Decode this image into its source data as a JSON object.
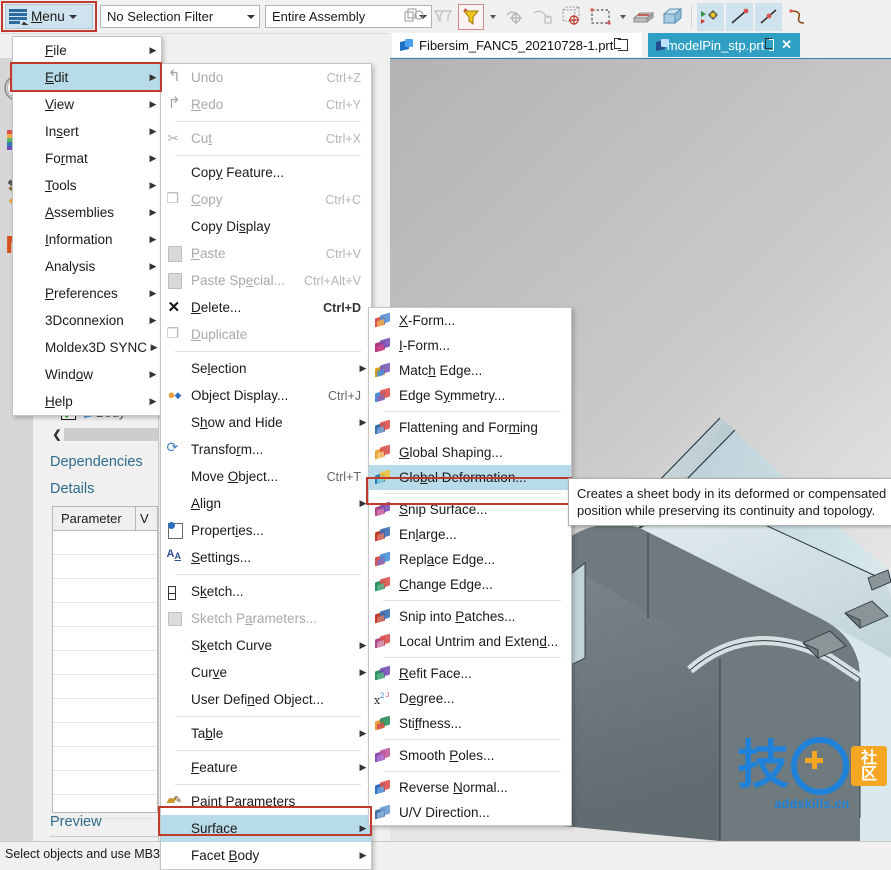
{
  "toolbar": {
    "menu_button_label": "Menu",
    "selection_filter": "No Selection Filter",
    "scope": "Entire Assembly",
    "icons": [
      "snap-point-icon",
      "filter-face-icon",
      "filter-active-icon",
      "filter-dropdown-caret",
      "point-constructor-icon",
      "curve-rule-icon",
      "wcs-dynamic-icon",
      "rectangle-select-icon",
      "select-dropdown-caret",
      "block-icon",
      "box-icon",
      "move-face-icon",
      "line-icon",
      "line-point-icon",
      "spline-icon"
    ]
  },
  "tabs": [
    {
      "label": "Fibersim_FANC5_20210728-1.prt",
      "active": false,
      "closeable": false
    },
    {
      "label": "modelPin_stp.prt",
      "active": true,
      "closeable": true
    }
  ],
  "main_menu": {
    "items": [
      {
        "label": "File",
        "underline": "F",
        "submenu": true,
        "highlighted": false
      },
      {
        "label": "Edit",
        "underline": "E",
        "submenu": true,
        "highlighted": true
      },
      {
        "label": "View",
        "underline": "V",
        "submenu": true,
        "highlighted": false
      },
      {
        "label": "Insert",
        "underline": "s",
        "submenu": true,
        "highlighted": false
      },
      {
        "label": "Format",
        "underline": "r",
        "submenu": true,
        "highlighted": false
      },
      {
        "label": "Tools",
        "underline": "T",
        "submenu": true,
        "highlighted": false
      },
      {
        "label": "Assemblies",
        "underline": "A",
        "submenu": true,
        "highlighted": false
      },
      {
        "label": "Information",
        "underline": "I",
        "submenu": true,
        "highlighted": false
      },
      {
        "label": "Analysis",
        "underline": "",
        "submenu": true,
        "highlighted": false
      },
      {
        "label": "Preferences",
        "underline": "P",
        "submenu": true,
        "highlighted": false
      },
      {
        "label": "3Dconnexion",
        "underline": "",
        "submenu": true,
        "highlighted": false
      },
      {
        "label": "Moldex3D SYNC",
        "underline": "",
        "submenu": true,
        "highlighted": false
      },
      {
        "label": "Window",
        "underline": "o",
        "submenu": true,
        "highlighted": false
      },
      {
        "label": "Help",
        "underline": "H",
        "submenu": true,
        "highlighted": false
      }
    ]
  },
  "edit_menu": {
    "items": [
      {
        "type": "item",
        "label": "Undo",
        "shortcut": "Ctrl+Z",
        "icon": "undo-icon",
        "disabled": true,
        "submenu": false
      },
      {
        "type": "item",
        "label": "Redo",
        "shortcut": "Ctrl+Y",
        "icon": "redo-icon",
        "disabled": true,
        "submenu": false
      },
      {
        "type": "sep"
      },
      {
        "type": "item",
        "label": "Cut",
        "shortcut": "Ctrl+X",
        "icon": "cut-icon",
        "disabled": true,
        "submenu": false
      },
      {
        "type": "sep"
      },
      {
        "type": "item",
        "label": "Copy Feature...",
        "shortcut": "",
        "icon": "",
        "disabled": false,
        "submenu": false
      },
      {
        "type": "item",
        "label": "Copy",
        "shortcut": "Ctrl+C",
        "icon": "copy-icon",
        "disabled": true,
        "submenu": false
      },
      {
        "type": "item",
        "label": "Copy Display",
        "shortcut": "",
        "icon": "",
        "disabled": false,
        "submenu": false
      },
      {
        "type": "item",
        "label": "Paste",
        "shortcut": "Ctrl+V",
        "icon": "paste-icon",
        "disabled": true,
        "submenu": false
      },
      {
        "type": "item",
        "label": "Paste Special...",
        "shortcut": "Ctrl+Alt+V",
        "icon": "paste-special-icon",
        "disabled": true,
        "submenu": false
      },
      {
        "type": "item",
        "label": "Delete...",
        "shortcut": "Ctrl+D",
        "icon": "delete-icon",
        "disabled": false,
        "submenu": false
      },
      {
        "type": "item",
        "label": "Duplicate",
        "shortcut": "",
        "icon": "duplicate-icon",
        "disabled": true,
        "submenu": false
      },
      {
        "type": "sep"
      },
      {
        "type": "item",
        "label": "Selection",
        "shortcut": "",
        "icon": "",
        "disabled": false,
        "submenu": true
      },
      {
        "type": "item",
        "label": "Object Display...",
        "shortcut": "Ctrl+J",
        "icon": "object-display-icon",
        "disabled": false,
        "submenu": false
      },
      {
        "type": "item",
        "label": "Show and Hide",
        "shortcut": "",
        "icon": "",
        "disabled": false,
        "submenu": true
      },
      {
        "type": "item",
        "label": "Transform...",
        "shortcut": "",
        "icon": "transform-icon",
        "disabled": false,
        "submenu": false
      },
      {
        "type": "item",
        "label": "Move Object...",
        "shortcut": "Ctrl+T",
        "icon": "move-object-icon",
        "disabled": false,
        "submenu": false
      },
      {
        "type": "item",
        "label": "Align",
        "shortcut": "",
        "icon": "",
        "disabled": false,
        "submenu": true
      },
      {
        "type": "item",
        "label": "Properties...",
        "shortcut": "",
        "icon": "properties-icon",
        "disabled": false,
        "submenu": false
      },
      {
        "type": "item",
        "label": "Settings...",
        "shortcut": "",
        "icon": "settings-icon",
        "disabled": false,
        "submenu": false
      },
      {
        "type": "sep"
      },
      {
        "type": "item",
        "label": "Sketch...",
        "shortcut": "",
        "icon": "sketch-icon",
        "disabled": false,
        "submenu": false
      },
      {
        "type": "item",
        "label": "Sketch Parameters...",
        "shortcut": "",
        "icon": "sketch-params-icon",
        "disabled": true,
        "submenu": false
      },
      {
        "type": "item",
        "label": "Sketch Curve",
        "shortcut": "",
        "icon": "",
        "disabled": false,
        "submenu": true
      },
      {
        "type": "item",
        "label": "Curve",
        "shortcut": "",
        "icon": "",
        "disabled": false,
        "submenu": true
      },
      {
        "type": "item",
        "label": "User Defined Object...",
        "shortcut": "",
        "icon": "",
        "disabled": false,
        "submenu": false
      },
      {
        "type": "sep"
      },
      {
        "type": "item",
        "label": "Table",
        "shortcut": "",
        "icon": "",
        "disabled": false,
        "submenu": true
      },
      {
        "type": "sep"
      },
      {
        "type": "item",
        "label": "Feature",
        "shortcut": "",
        "icon": "",
        "disabled": false,
        "submenu": true
      },
      {
        "type": "sep"
      },
      {
        "type": "item",
        "label": "Paint Parameters",
        "shortcut": "",
        "icon": "paint-params-icon",
        "disabled": false,
        "submenu": false
      },
      {
        "type": "item",
        "label": "Surface",
        "shortcut": "",
        "icon": "",
        "disabled": false,
        "submenu": true,
        "highlighted": true
      },
      {
        "type": "item",
        "label": "Facet Body",
        "shortcut": "",
        "icon": "",
        "disabled": false,
        "submenu": true
      }
    ]
  },
  "surface_menu": {
    "items": [
      {
        "type": "item",
        "label": "X-Form...",
        "icon": "x-form-icon",
        "c1": "#d9534f",
        "c2": "#5a8fd4",
        "c3": "#f0ad4e"
      },
      {
        "type": "item",
        "label": "I-Form...",
        "icon": "i-form-icon",
        "c1": "#b0357a",
        "c2": "#7a4fb5",
        "c3": "#d04a8a"
      },
      {
        "type": "item",
        "label": "Match Edge...",
        "icon": "match-edge-icon",
        "c1": "#d4a017",
        "c2": "#7b5cb8",
        "c3": "#4a90d9"
      },
      {
        "type": "item",
        "label": "Edge Symmetry...",
        "icon": "edge-symmetry-icon",
        "c1": "#4a90d9",
        "c2": "#d9534f",
        "c3": "#8e6bb5"
      },
      {
        "type": "sep"
      },
      {
        "type": "item",
        "label": "Flattening and Forming",
        "icon": "flattening-forming-icon",
        "c1": "#3b6fb0",
        "c2": "#d9534f",
        "c3": "#7aa5d8"
      },
      {
        "type": "item",
        "label": "Global Shaping...",
        "icon": "global-shaping-icon",
        "c1": "#e8a33d",
        "c2": "#d9534f",
        "c3": "#f2c879"
      },
      {
        "type": "item",
        "label": "Global Deformation...",
        "icon": "global-deformation-icon",
        "c1": "#2f7fb5",
        "c2": "#f0c040",
        "c3": "#7fd0e0",
        "highlighted": true
      },
      {
        "type": "sep"
      },
      {
        "type": "item",
        "label": "Snip Surface...",
        "icon": "snip-surface-icon",
        "c1": "#b0478a",
        "c2": "#7a4fb5",
        "c3": "#d87ab0"
      },
      {
        "type": "item",
        "label": "Enlarge...",
        "icon": "enlarge-icon",
        "c1": "#c0392b",
        "c2": "#3b6fb0",
        "c3": "#e07a6a"
      },
      {
        "type": "item",
        "label": "Replace Edge...",
        "icon": "replace-edge-icon",
        "c1": "#d9534f",
        "c2": "#4a90d9",
        "c3": "#8e6bb5"
      },
      {
        "type": "item",
        "label": "Change Edge...",
        "icon": "change-edge-icon",
        "c1": "#2f8f5f",
        "c2": "#d9534f",
        "c3": "#5ab58a"
      },
      {
        "type": "sep"
      },
      {
        "type": "item",
        "label": "Snip into Patches...",
        "icon": "snip-patches-icon",
        "c1": "#c0392b",
        "c2": "#3b6fb0",
        "c3": "#d07a6a"
      },
      {
        "type": "item",
        "label": "Local Untrim and Extend...",
        "icon": "local-untrim-icon",
        "c1": "#b0478a",
        "c2": "#d9534f",
        "c3": "#d8a0c0"
      },
      {
        "type": "sep"
      },
      {
        "type": "item",
        "label": "Refit Face...",
        "icon": "refit-face-icon",
        "c1": "#2f8f5f",
        "c2": "#7a4fb5",
        "c3": "#5ab58a"
      },
      {
        "type": "item",
        "label": "Degree...",
        "icon": "degree-icon",
        "c1": "#333333",
        "c2": "#2f6fc0",
        "c3": "#d9534f"
      },
      {
        "type": "item",
        "label": "Stiffness...",
        "icon": "stiffness-icon",
        "c1": "#e8a33d",
        "c2": "#2f8f5f",
        "c3": "#d9534f"
      },
      {
        "type": "sep"
      },
      {
        "type": "item",
        "label": "Smooth Poles...",
        "icon": "smooth-poles-icon",
        "c1": "#8e4fb5",
        "c2": "#c05a9a",
        "c3": "#b07ad0"
      },
      {
        "type": "sep"
      },
      {
        "type": "item",
        "label": "Reverse Normal...",
        "icon": "reverse-normal-icon",
        "c1": "#2f6fc0",
        "c2": "#d9534f",
        "c3": "#6aa5e0"
      },
      {
        "type": "item",
        "label": "U/V Direction...",
        "icon": "uv-direction-icon",
        "c1": "#4a6fa0",
        "c2": "#6a9ad0",
        "c3": "#8ab0d8"
      }
    ]
  },
  "tooltip": {
    "text": "Creates a sheet body in its deformed or compensated position while preserving its continuity and topology."
  },
  "left_strip": {
    "icons": [
      "history-clock-icon",
      "rainbow-pencil-icon",
      "hammer-wrench-icon",
      "moldex-m-icon"
    ]
  },
  "left_panel": {
    "tree_node_label": "Body",
    "sections": {
      "dependencies": "Dependencies",
      "details": "Details",
      "preview": "Preview"
    },
    "details_table": {
      "columns": [
        "Parameter",
        "V"
      ],
      "rows": [
        "",
        "",
        "",
        "",
        "",
        "",
        "",
        "",
        "",
        "",
        "",
        ""
      ]
    }
  },
  "status_bar": {
    "message": "Select objects and use MB3,"
  },
  "watermark": {
    "glyph1": "技",
    "plus": "+",
    "square_top": "社",
    "square_bottom": "区",
    "domain": "addskills.cn"
  },
  "colors": {
    "highlight": "#b7dbe8",
    "red_box": "#c0392b",
    "tab_active": "#2f9fc4",
    "panel_label": "#2e6b8a"
  }
}
